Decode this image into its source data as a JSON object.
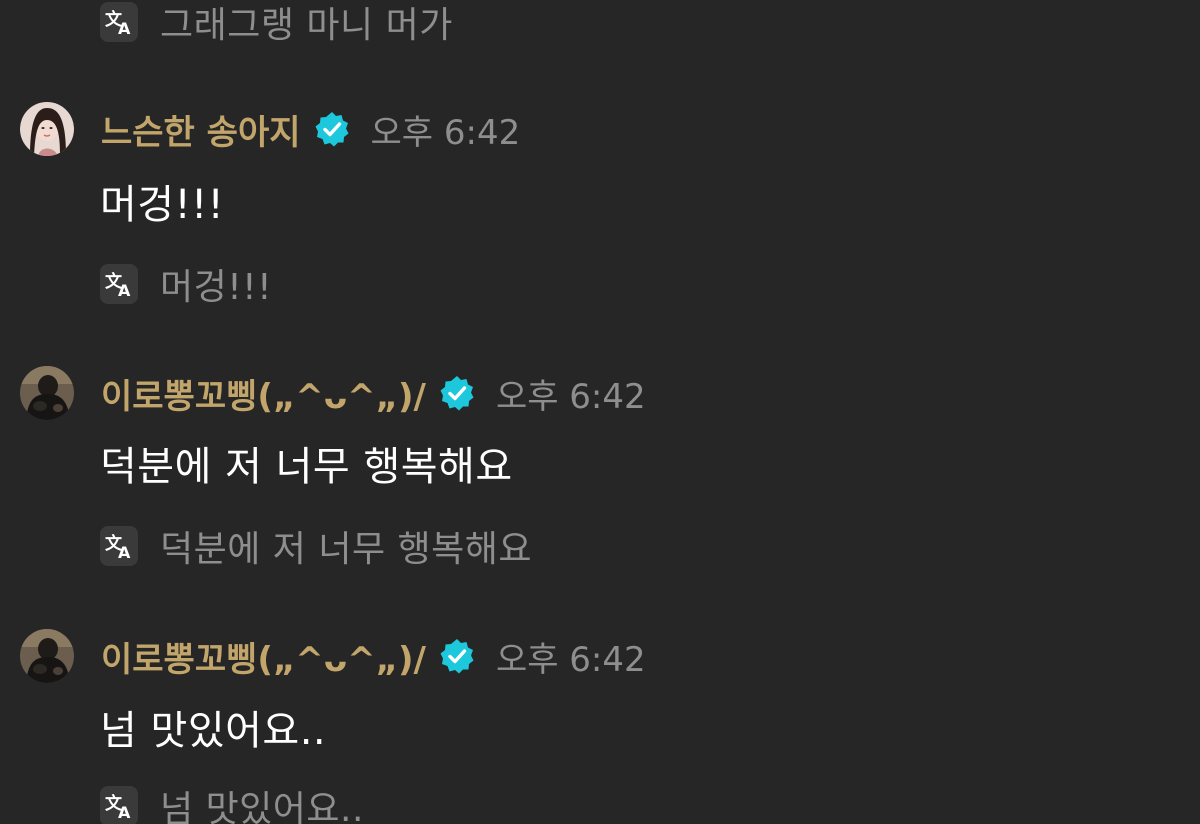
{
  "prev_translation": {
    "text": "그래그랭 마니 머가"
  },
  "messages": [
    {
      "username": "느슨한 송아지",
      "verified": true,
      "timestamp": "오후 6:42",
      "text": "머겅!!!",
      "translation": "머겅!!!",
      "avatar": "avatar-woman-photo"
    },
    {
      "username": "이로뽕꼬삥(„^ᴗ^„)/",
      "verified": true,
      "timestamp": "오후 6:42",
      "text": "덕분에 저 너무 행복해요",
      "translation": "덕분에 저 너무 행복해요",
      "avatar": "avatar-dark-photo"
    },
    {
      "username": "이로뽕꼬삥(„^ᴗ^„)/",
      "verified": true,
      "timestamp": "오후 6:42",
      "text": "넘 맛있어요..",
      "translation": "넘 맛있어요..",
      "avatar": "avatar-dark-photo"
    }
  ],
  "colors": {
    "background": "#262626",
    "username": "#c2a56b",
    "verified_badge": "#1ec8dc",
    "muted_text": "#8e8e8e"
  },
  "icons": {
    "translate": "translate-icon",
    "verified": "verified-badge-icon"
  }
}
